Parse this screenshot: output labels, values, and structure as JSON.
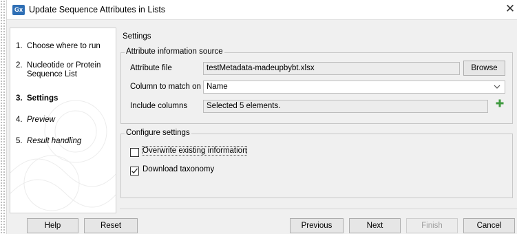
{
  "window": {
    "app_icon_text": "Gx",
    "title": "Update Sequence Attributes in Lists",
    "close_symbol": "✕"
  },
  "steps": [
    {
      "num": "1.",
      "label": "Choose where to run",
      "state": "done"
    },
    {
      "num": "2.",
      "label": "Nucleotide or Protein Sequence List",
      "state": "done"
    },
    {
      "num": "3.",
      "label": "Settings",
      "state": "current"
    },
    {
      "num": "4.",
      "label": "Preview",
      "state": "future"
    },
    {
      "num": "5.",
      "label": "Result handling",
      "state": "future"
    }
  ],
  "settings": {
    "section_label": "Settings",
    "attribute_source": {
      "title": "Attribute information source",
      "attribute_file_label": "Attribute file",
      "attribute_file_value": "testMetadata-madeupbybt.xlsx",
      "browse_label": "Browse",
      "column_match_label": "Column to match on",
      "column_match_value": "Name",
      "include_columns_label": "Include columns",
      "include_columns_value": "Selected 5 elements."
    },
    "configure": {
      "title": "Configure settings",
      "overwrite_label": "Overwrite existing information",
      "overwrite_checked": false,
      "download_label": "Download taxonomy",
      "download_checked": true
    }
  },
  "footer": {
    "help": "Help",
    "reset": "Reset",
    "previous": "Previous",
    "next": "Next",
    "finish": "Finish",
    "cancel": "Cancel"
  },
  "icons": {
    "dropdown": "chevron-down-icon",
    "add": "plus-icon",
    "check": "check-icon"
  },
  "colors": {
    "app_icon_bg": "#2f6fb5",
    "add_icon": "#3f9a3f",
    "window_bg": "#f0f0f0"
  }
}
